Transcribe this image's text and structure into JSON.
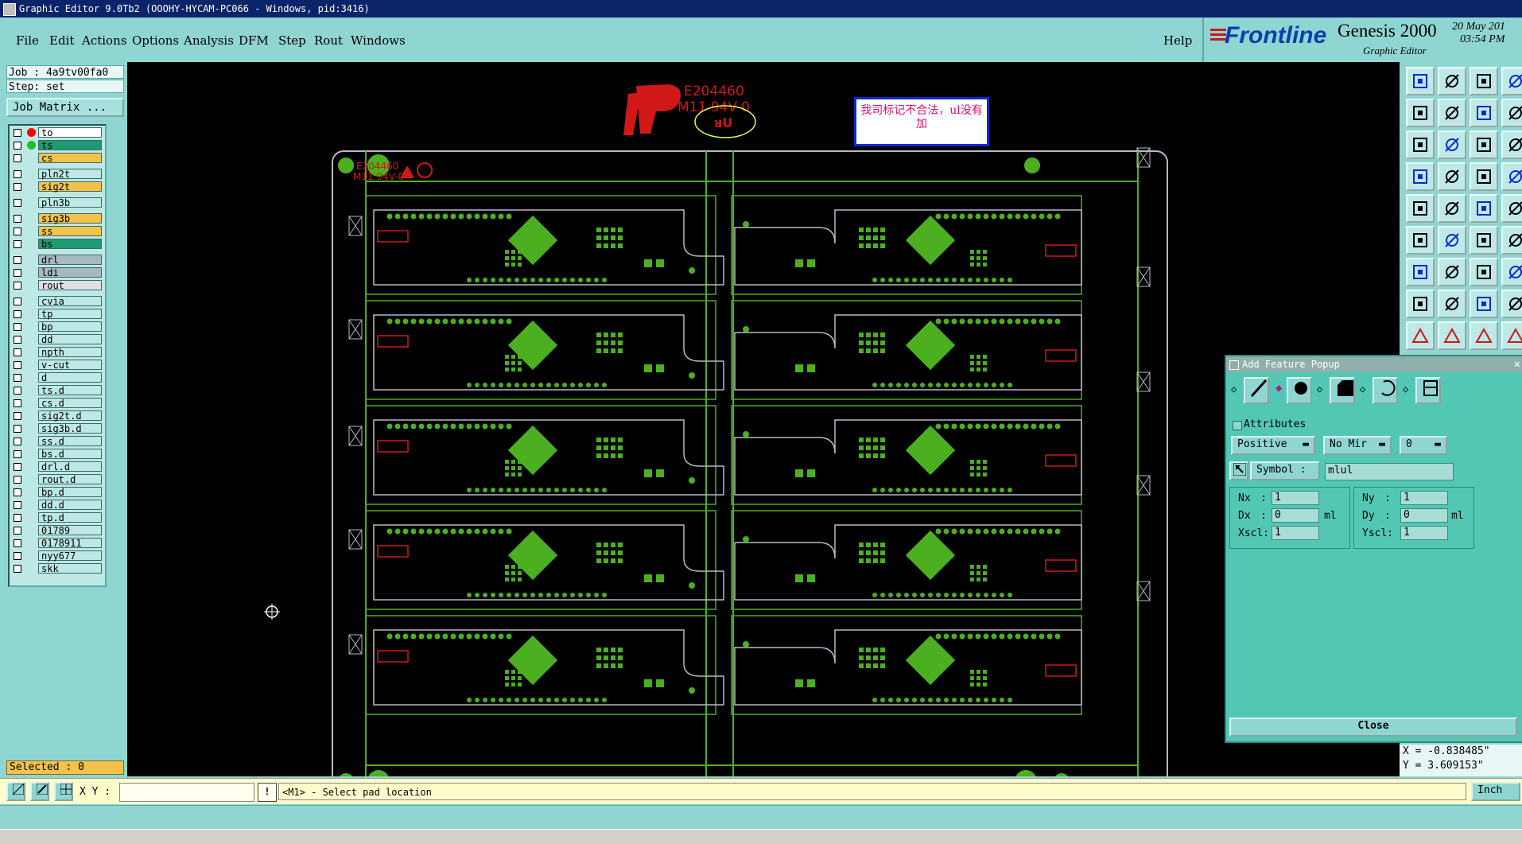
{
  "window": {
    "title": "Graphic Editor 9.0Tb2 (OOOHY-HYCAM-PC066 - Windows, pid:3416)"
  },
  "menu": {
    "file": "File",
    "edit": "Edit",
    "actions": "Actions",
    "options": "Options",
    "analysis": "Analysis",
    "dfm": "DFM",
    "step": "Step",
    "rout": "Rout",
    "windows": "Windows",
    "help": "Help"
  },
  "brand": {
    "logo": "Frontline",
    "product": "Genesis 2000",
    "subtitle": "Graphic Editor",
    "date": "20 May 201",
    "time": "03:54 PM"
  },
  "job": {
    "job_line": "Job : 4a9tv00fa0",
    "step_line": "Step: set",
    "matrix_button": "Job Matrix ..."
  },
  "layers": [
    {
      "name": "to",
      "color": "#ffffff",
      "dot": "#ff0000"
    },
    {
      "name": "ts",
      "color": "#1f9a72",
      "dot": "#1fc01f"
    },
    {
      "name": "cs",
      "color": "#f2c24a",
      "dot": ""
    },
    {
      "name": "pln2t",
      "color": "#bde8e5",
      "dot": ""
    },
    {
      "name": "sig2t",
      "color": "#f2c24a",
      "dot": ""
    },
    {
      "name": "pln3b",
      "color": "#bde8e5",
      "dot": ""
    },
    {
      "name": "sig3b",
      "color": "#f2c24a",
      "dot": ""
    },
    {
      "name": "ss",
      "color": "#f2c24a",
      "dot": ""
    },
    {
      "name": "bs",
      "color": "#1f9a72",
      "dot": ""
    },
    {
      "name": "drl",
      "color": "#a8b8c0",
      "dot": ""
    },
    {
      "name": "ldi",
      "color": "#a8b8c0",
      "dot": ""
    },
    {
      "name": "rout",
      "color": "#e0e0e0",
      "dot": ""
    },
    {
      "name": "cvia",
      "color": "#bde8e5",
      "dot": ""
    },
    {
      "name": "tp",
      "color": "#bde8e5",
      "dot": ""
    },
    {
      "name": "bp",
      "color": "#bde8e5",
      "dot": ""
    },
    {
      "name": "dd",
      "color": "#bde8e5",
      "dot": ""
    },
    {
      "name": "npth",
      "color": "#bde8e5",
      "dot": ""
    },
    {
      "name": "v-cut",
      "color": "#bde8e5",
      "dot": ""
    },
    {
      "name": "d",
      "color": "#bde8e5",
      "dot": ""
    },
    {
      "name": "ts.d",
      "color": "#bde8e5",
      "dot": ""
    },
    {
      "name": "cs.d",
      "color": "#bde8e5",
      "dot": ""
    },
    {
      "name": "sig2t.d",
      "color": "#bde8e5",
      "dot": ""
    },
    {
      "name": "sig3b.d",
      "color": "#bde8e5",
      "dot": ""
    },
    {
      "name": "ss.d",
      "color": "#bde8e5",
      "dot": ""
    },
    {
      "name": "bs.d",
      "color": "#bde8e5",
      "dot": ""
    },
    {
      "name": "drl.d",
      "color": "#bde8e5",
      "dot": ""
    },
    {
      "name": "rout.d",
      "color": "#bde8e5",
      "dot": ""
    },
    {
      "name": "bp.d",
      "color": "#bde8e5",
      "dot": ""
    },
    {
      "name": "dd.d",
      "color": "#bde8e5",
      "dot": ""
    },
    {
      "name": "tp.d",
      "color": "#bde8e5",
      "dot": ""
    },
    {
      "name": "01789",
      "color": "#bde8e5",
      "dot": ""
    },
    {
      "name": "0178911",
      "color": "#bde8e5",
      "dot": ""
    },
    {
      "name": "nyy677",
      "color": "#bde8e5",
      "dot": ""
    },
    {
      "name": "skk",
      "color": "#bde8e5",
      "dot": ""
    }
  ],
  "selected": "Selected : 0",
  "canvas": {
    "logo_text_1": "E204460",
    "logo_text_2": "M11 94V-0",
    "board_mark_1": "E204460",
    "board_mark_2": "M11 94V-0",
    "note": "我司标记不合法，ul没有加"
  },
  "popup": {
    "title": "Add Feature Popup",
    "attributes": "Attributes",
    "polarity": "Positive",
    "mirror": "No Mir",
    "angle": "0",
    "symbol_label": "Symbol :",
    "symbol_value": "mlul",
    "nx_label": "Nx",
    "nx": "1",
    "dx_label": "Dx",
    "dx": "0",
    "xscl_label": "Xscl:",
    "xscl": "1",
    "ny_label": "Ny",
    "ny": "1",
    "dy_label": "Dy",
    "dy": "0",
    "yscl_label": "Yscl:",
    "yscl": "1",
    "unit": "ml",
    "close": "Close"
  },
  "coords": {
    "x": "X = -0.838485\"",
    "y": "Y = 3.609153\""
  },
  "status": {
    "xy_label": "X Y :",
    "xy_value": "",
    "prompt": "<M1> - Select pad location",
    "units": "Inch"
  }
}
